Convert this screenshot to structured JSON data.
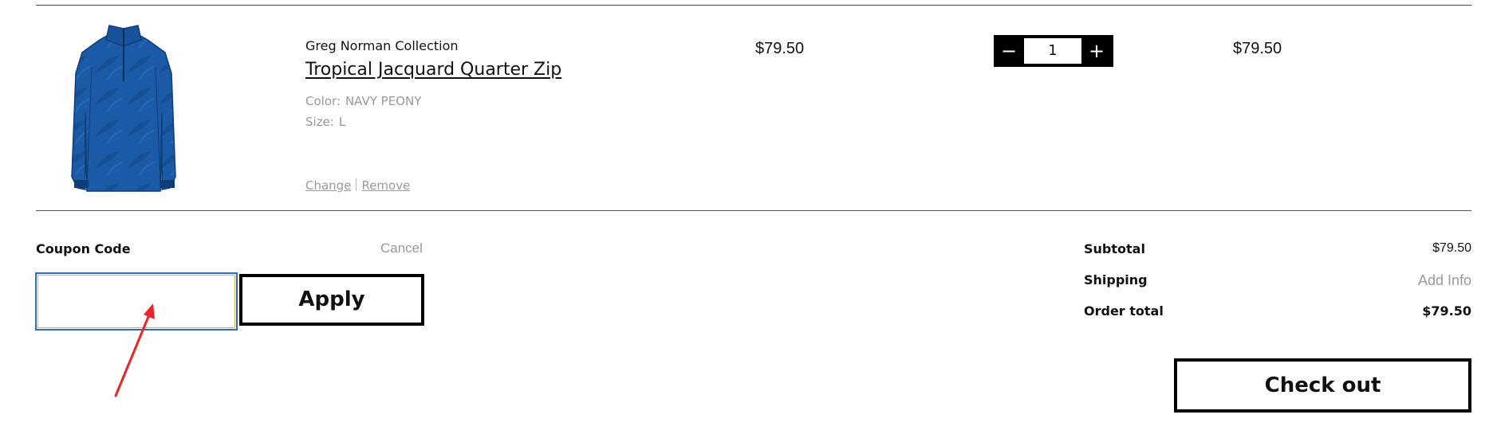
{
  "cart_item": {
    "brand": "Greg Norman Collection",
    "name": "Tropical Jacquard Quarter Zip",
    "color_label": "Color:",
    "color_value": "NAVY PEONY",
    "size_label": "Size:",
    "size_value": "L",
    "change_label": "Change",
    "remove_label": "Remove",
    "price": "$79.50",
    "quantity": "1",
    "decrement_glyph": "−",
    "increment_glyph": "+",
    "line_total": "$79.50",
    "image_icon": "quarter-zip-shirt-icon",
    "image_color": "#1a5aa6"
  },
  "coupon": {
    "label": "Coupon Code",
    "cancel_label": "Cancel",
    "input_value": "",
    "apply_label": "Apply"
  },
  "summary": {
    "subtotal_label": "Subtotal",
    "subtotal_value": "$79.50",
    "shipping_label": "Shipping",
    "shipping_value": "Add Info",
    "total_label": "Order total",
    "total_value": "$79.50"
  },
  "checkout": {
    "label": "Check out"
  },
  "annotation": {
    "arrow_color": "#e8262a"
  }
}
